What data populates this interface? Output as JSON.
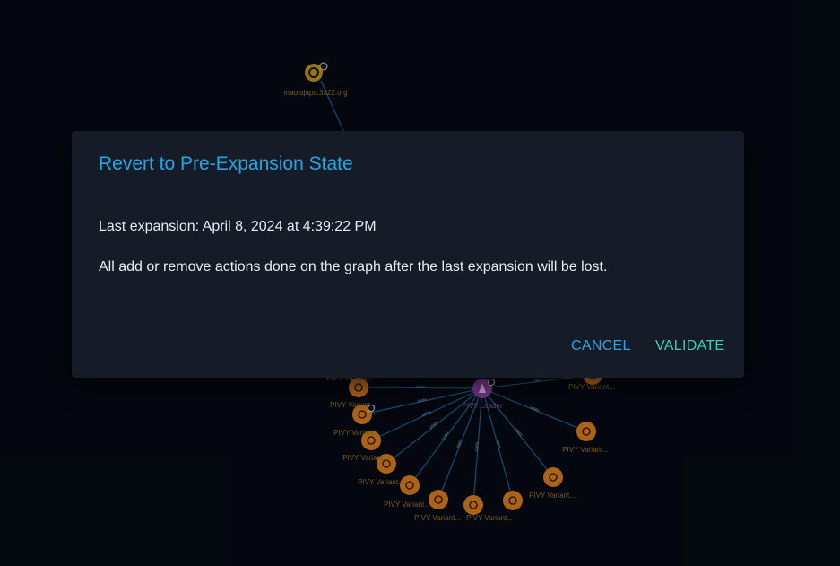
{
  "graph": {
    "top_node_label": "maofajapa.3322.org",
    "center_node_label": "PIVY Loader",
    "variant_label": "PIVY Variant...",
    "edge_label": "uses",
    "colors": {
      "background": "#050912",
      "edge": "#0f5f88",
      "variant_node": "#c9751c",
      "center_node": "#8a3d9a",
      "domain_node": "#b08a1a"
    }
  },
  "dialog": {
    "title": "Revert to Pre-Expansion State",
    "last_expansion": "Last expansion: April 8, 2024 at 4:39:22 PM",
    "warning": "All add or remove actions done on the graph after the last expansion will be lost.",
    "cancel_label": "CANCEL",
    "validate_label": "VALIDATE",
    "colors": {
      "title": "#1fa8e6",
      "cancel": "#1fa8e6",
      "validate": "#2fd6b0",
      "panel": "#161c27"
    }
  }
}
